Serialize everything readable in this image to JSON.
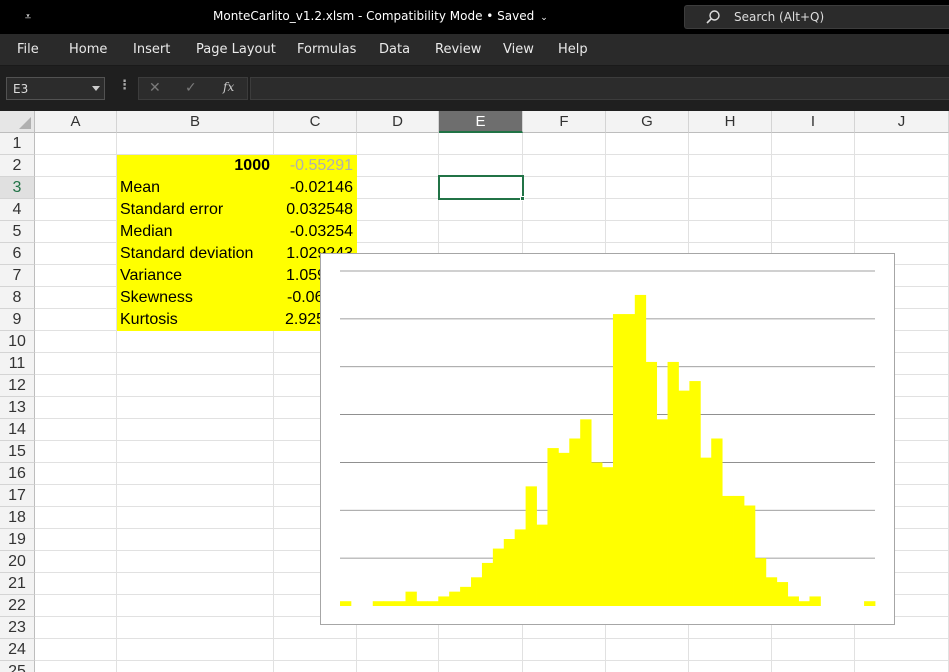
{
  "titlebar": {
    "qa_symbol": "⩡",
    "title": "MonteCarlito_v1.2.xlsm  -  Compatibility Mode • Saved",
    "caret": "⌄",
    "search_label": "Search (Alt+Q)"
  },
  "ribbon": {
    "tabs": [
      "File",
      "Home",
      "Insert",
      "Page Layout",
      "Formulas",
      "Data",
      "Review",
      "View",
      "Help"
    ]
  },
  "formula_bar": {
    "name_box": "E3",
    "more": "⋮",
    "cancel": "✕",
    "enter": "✓",
    "fx": "fx",
    "content": ""
  },
  "sheet": {
    "columns": [
      "A",
      "B",
      "C",
      "D",
      "E",
      "F",
      "G",
      "H",
      "I",
      "J"
    ],
    "selected_column": "E",
    "rows": [
      "1",
      "2",
      "3",
      "4",
      "5",
      "6",
      "7",
      "8",
      "9",
      "10",
      "11",
      "12",
      "13",
      "14",
      "15",
      "16",
      "17",
      "18",
      "19",
      "20",
      "21",
      "22",
      "23",
      "24",
      "25"
    ],
    "selected_row": "3",
    "active_cell": "E3",
    "cells": {
      "B2": "1000",
      "C2": "-0.55291",
      "B3": "Mean",
      "C3": "-0.02146",
      "B4": "Standard error",
      "C4": "0.032548",
      "B5": "Median",
      "C5": "-0.03254",
      "B6": "Standard deviation",
      "C6": "1.029243",
      "B7": "Variance",
      "C7": "1.059",
      "B8": "Skewness",
      "C8": "-0.06",
      "B9": "Kurtosis",
      "C9": "2.925"
    },
    "yellow_fill": "#ffff00",
    "accent": "#217346"
  },
  "chart_data": {
    "type": "bar",
    "values": [
      1,
      0,
      0,
      1,
      1,
      1,
      3,
      1,
      1,
      2,
      3,
      4,
      6,
      9,
      12,
      14,
      16,
      25,
      17,
      33,
      32,
      35,
      39,
      30,
      29,
      61,
      61,
      65,
      51,
      39,
      51,
      45,
      47,
      31,
      35,
      23,
      23,
      21,
      10,
      6,
      5,
      2,
      1,
      2,
      0,
      0,
      0,
      0,
      1
    ],
    "ylim": [
      0,
      70
    ],
    "gridlines": [
      10,
      20,
      30,
      40,
      50,
      60,
      70
    ],
    "grid": true,
    "bar_color": "#ffff00",
    "gridline_color": "#808080"
  }
}
